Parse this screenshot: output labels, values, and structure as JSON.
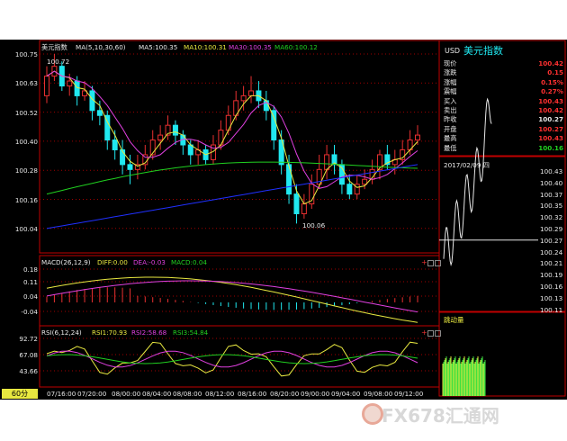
{
  "colors": {
    "up": "#e83030",
    "down": "#20e8f0",
    "ma5": "#e8e8e8",
    "ma10": "#e8e840",
    "ma20": "#e040e0",
    "ma30": "#20d020",
    "ma60": "#2030ff",
    "grid": "#a00000",
    "text": "#e8e8e8",
    "frame": "#c00000",
    "panel_val": "#ff3030",
    "panel_lbl": "#e8e8e8",
    "highlight": "#ffff00"
  },
  "main": {
    "title": "美元指数",
    "ma_params": "MA(5,10,30,60)",
    "ma5": "MA5:100.35",
    "ma10": "MA10:100.31",
    "ma30": "MA30:100.35",
    "ma60": "MA60:100.12",
    "y_ticks": [
      "100.75",
      "100.63",
      "100.52",
      "100.40",
      "100.28",
      "100.16",
      "100.04"
    ],
    "max_label": "100.72",
    "min_label": "100.06"
  },
  "macd": {
    "title": "MACD(26,12,9)",
    "diff": "DIFF:0.00",
    "dea": "DEA:-0.03",
    "macd": "MACD:0.04",
    "y_ticks": [
      "0.18",
      "0.11",
      "0.04",
      "-0.04"
    ]
  },
  "rsi": {
    "title": "RSI(6,12,24)",
    "rsi1": "RSI1:70.93",
    "rsi2": "RSI2:58.68",
    "rsi3": "RSI3:54.84",
    "y_ticks": [
      "92.72",
      "67.08",
      "43.66"
    ]
  },
  "x_axis": {
    "period_button": "60分",
    "ticks": [
      "07/16:00",
      "07/20:00",
      "08/00:00",
      "08/04:00",
      "08/08:00",
      "08/12:00",
      "08/16:00",
      "08/20:00",
      "09/00:00",
      "09/04:00",
      "09/08:00",
      "09/12:00"
    ]
  },
  "side": {
    "header_code": "USD",
    "header_name": "美元指数",
    "rows": [
      {
        "label": "现价",
        "value": "100.42"
      },
      {
        "label": "涨跌",
        "value": "0.15"
      },
      {
        "label": "涨幅",
        "value": "0.15%"
      },
      {
        "label": "震幅",
        "value": "0.27%"
      },
      {
        "label": "买入",
        "value": "100.43"
      },
      {
        "label": "卖出",
        "value": "100.42"
      },
      {
        "label": "昨收",
        "value": "100.27"
      },
      {
        "label": "开盘",
        "value": "100.27"
      },
      {
        "label": "最高",
        "value": "100.43"
      },
      {
        "label": "最低",
        "value": "100.16"
      }
    ],
    "intraday_date": "2017/02/09  四",
    "intraday_ticks": [
      "100.43",
      "100.40",
      "100.37",
      "100.35",
      "100.32",
      "100.29",
      "100.27",
      "100.24",
      "100.21",
      "100.19",
      "100.16",
      "100.13",
      "100.11"
    ],
    "vol_title": "跳动量"
  },
  "watermark": "FX678汇通网"
}
